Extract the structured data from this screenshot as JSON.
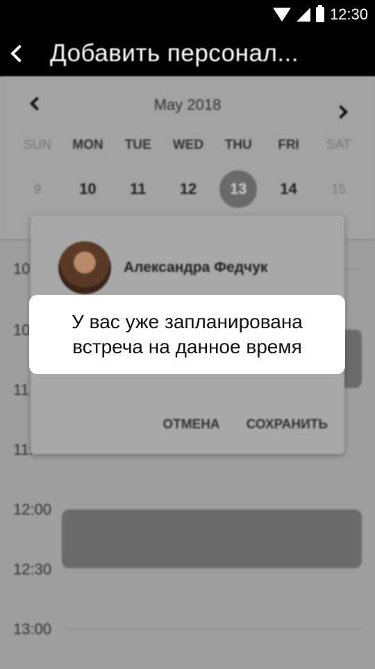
{
  "status_bar": {
    "time": "12:30",
    "icons": [
      "wifi-icon",
      "signal-icon",
      "battery-icon"
    ]
  },
  "app_bar": {
    "back_icon": "chevron-left-icon",
    "title": "Добавить персонал..."
  },
  "calendar": {
    "month_label": "May 2018",
    "prev_icon": "chevron-left-icon",
    "next_icon": "chevron-right-icon",
    "weekdays": [
      "SUN",
      "MON",
      "TUE",
      "WED",
      "THU",
      "FRI",
      "SAT"
    ],
    "days": [
      "9",
      "10",
      "11",
      "12",
      "13",
      "14",
      "15"
    ],
    "selected_day": "13"
  },
  "timeline": {
    "labels": [
      "10",
      "10",
      "11",
      "11:",
      "12:00",
      "12:30",
      "13:00"
    ]
  },
  "dialog": {
    "person_name": "Александра Федчук",
    "cancel_label": "ОТМЕНА",
    "save_label": "СОХРАНИТЬ"
  },
  "toast": {
    "line1": "У вас уже запланирована",
    "line2": "встреча на данное время"
  },
  "colors": {
    "appbar": "#000000",
    "overlay_bg": "#9e9e9e",
    "event_block": "#6b6b6b",
    "toast_bg": "#ffffff"
  }
}
